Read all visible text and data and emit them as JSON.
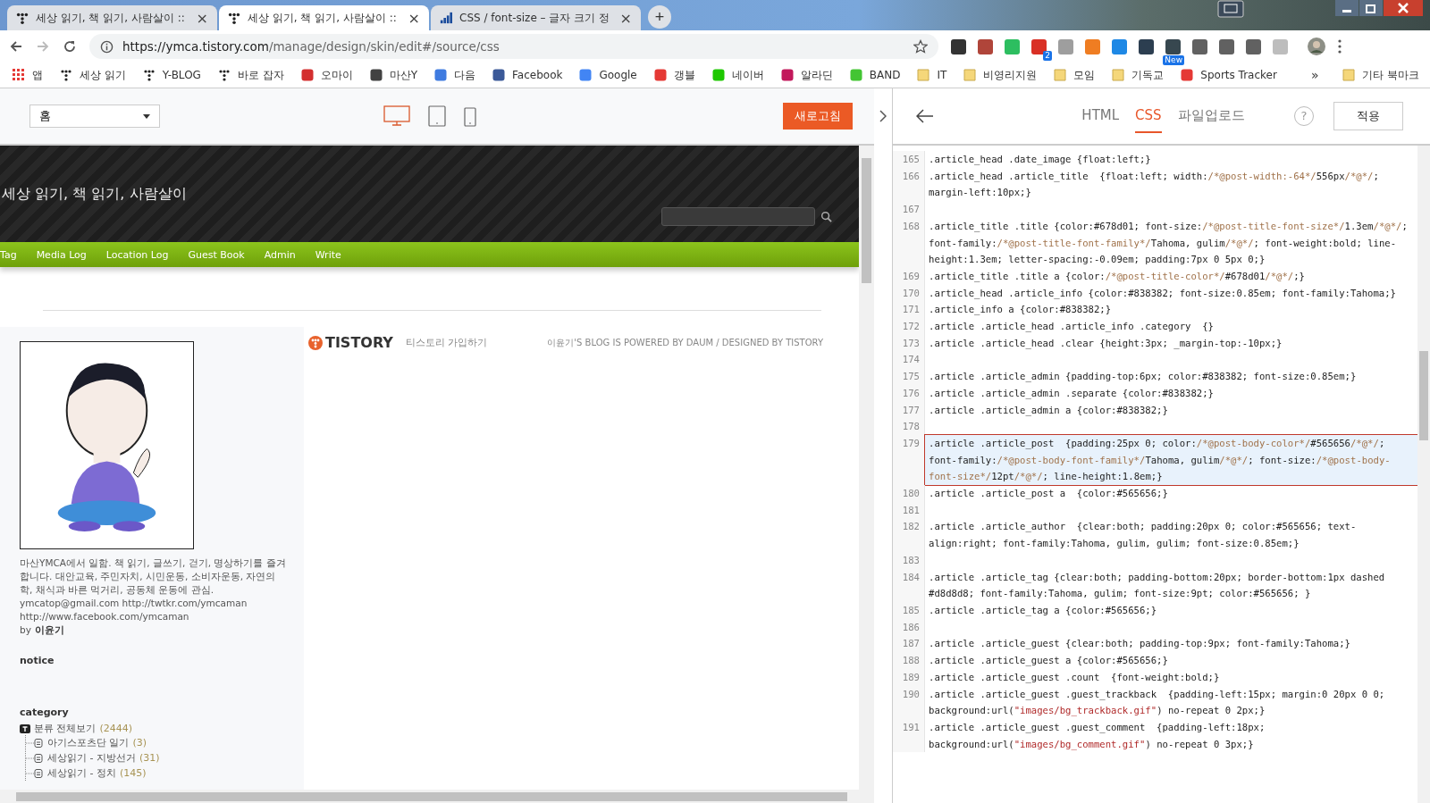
{
  "browser": {
    "tabs": [
      {
        "title": "세상 읽기, 책 읽기, 사람살이 ::",
        "kind": "dots",
        "selected": false,
        "close": "×"
      },
      {
        "title": "세상 읽기, 책 읽기, 사람살이 ::",
        "kind": "dots",
        "selected": true,
        "close": "×"
      },
      {
        "title": "CSS / font-size – 글자 크기 정",
        "kind": "bars",
        "selected": false,
        "close": "×"
      }
    ],
    "new_tab": "+",
    "url": {
      "host": "https://ymca.tistory.com",
      "path": "/manage/design/skin/edit#/source/css"
    },
    "extensions": [
      {
        "color": "#333333"
      },
      {
        "color": "#b0453a"
      },
      {
        "color": "#2dbe60"
      },
      {
        "color": "#d93025",
        "badge": "2"
      },
      {
        "color": "#9e9e9e"
      },
      {
        "color": "#ef7d22"
      },
      {
        "color": "#1e88e5"
      },
      {
        "color": "#2c3e50"
      },
      {
        "color": "#37474f",
        "badge": "New"
      },
      {
        "color": "#616161"
      },
      {
        "color": "#616161"
      },
      {
        "color": "#616161"
      },
      {
        "color": "#bdbdbd"
      }
    ],
    "bookmarks": [
      {
        "label": "앱",
        "kind": "apps",
        "color": "#e53935"
      },
      {
        "label": "세상 읽기",
        "kind": "dots",
        "color": "#222222"
      },
      {
        "label": "Y-BLOG",
        "kind": "dots",
        "color": "#222222"
      },
      {
        "label": "바로 잡자",
        "kind": "dots",
        "color": "#222222"
      },
      {
        "label": "오마이",
        "kind": "site",
        "color": "#d32f2f"
      },
      {
        "label": "마산Y",
        "kind": "site",
        "color": "#424242"
      },
      {
        "label": "다음",
        "kind": "site",
        "color": "#3f7be0"
      },
      {
        "label": "Facebook",
        "kind": "site",
        "color": "#3b5998"
      },
      {
        "label": "Google",
        "kind": "site",
        "color": "#4285f4"
      },
      {
        "label": "갱블",
        "kind": "site",
        "color": "#e53935"
      },
      {
        "label": "네이버",
        "kind": "site",
        "color": "#1ec800"
      },
      {
        "label": "알라딘",
        "kind": "site",
        "color": "#c2185b"
      },
      {
        "label": "BAND",
        "kind": "site",
        "color": "#43c533"
      },
      {
        "label": "IT",
        "kind": "folder",
        "color": "#f5d77a"
      },
      {
        "label": "비영리지원",
        "kind": "folder",
        "color": "#f5d77a"
      },
      {
        "label": "모임",
        "kind": "folder",
        "color": "#f5d77a"
      },
      {
        "label": "기독교",
        "kind": "folder",
        "color": "#f5d77a"
      },
      {
        "label": "Sports Tracker",
        "kind": "site",
        "color": "#e53935"
      }
    ],
    "bookmarks_more": "»",
    "other_bookmarks": "기타 북마크"
  },
  "preview_toolbar": {
    "page_select": "홈",
    "devices": [
      {
        "kind": "desktop",
        "selected": true
      },
      {
        "kind": "tablet",
        "selected": false
      },
      {
        "kind": "phone",
        "selected": false
      }
    ],
    "refresh_button": "새로고침"
  },
  "blog": {
    "title": "세상 읽기, 책 읽기, 사람살이",
    "nav": [
      "Tag",
      "Media Log",
      "Location Log",
      "Guest Book",
      "Admin",
      "Write"
    ],
    "profile": {
      "picture": {
        "kind": "picture"
      },
      "bio": "마산YMCA에서 일함. 책 읽기, 글쓰기, 걷기, 명상하기를 즐겨합니다. 대안교육, 주민자치, 시민운동, 소비자운동, 자연의학, 채식과 바른 먹거리, 공동체 운동에 관심.",
      "contact": [
        "ymcatop@gmail.com  http://twtkr.com/ymcaman",
        "http://www.facebook.com/ymcaman"
      ],
      "by": "by",
      "author": "이윤기"
    },
    "notice": "notice",
    "category": {
      "heading": "category",
      "root": {
        "label": "분류 전체보기",
        "count": "(2444)",
        "children": [
          {
            "label": "아기스포츠단 일기",
            "count": "(3)"
          },
          {
            "label": "세상읽기 - 지방선거",
            "count": "(31)"
          },
          {
            "label": "세상읽기 - 정치",
            "count": "(145)"
          }
        ]
      }
    },
    "footer": {
      "logo": "TISTORY",
      "join": "티스토리 가입하기",
      "credit": "이윤기'S BLOG IS POWERED BY DAUM / DESIGNED BY TISTORY"
    }
  },
  "editor": {
    "tabs": [
      {
        "label": "HTML",
        "selected": false
      },
      {
        "label": "CSS",
        "selected": true
      },
      {
        "label": "파일업로드",
        "selected": false
      }
    ],
    "help": "?",
    "apply_button": "적용",
    "lines": [
      {
        "num": "165",
        "text": ".article_head .date_image {float:left;}",
        "highlighted": false
      },
      {
        "num": "166",
        "text": ".article_head .article_title  {float:left; width:/*@post-width:-64*/556px/*@*/; margin-left:10px;}",
        "highlighted": false
      },
      {
        "num": "167",
        "highlighted": false
      },
      {
        "num": "168",
        "text": ".article_title .title {color:#678d01; font-size:/*@post-title-font-size*/1.3em/*@*/; font-family:/*@post-title-font-family*/Tahoma, gulim/*@*/; font-weight:bold; line-height:1.3em; letter-spacing:-0.09em; padding:7px 0 5px 0;}",
        "highlighted": false
      },
      {
        "num": "169",
        "text": ".article_title .title a {color:/*@post-title-color*/#678d01/*@*/;}",
        "highlighted": false
      },
      {
        "num": "170",
        "text": ".article_head .article_info {color:#838382; font-size:0.85em; font-family:Tahoma;}",
        "highlighted": false
      },
      {
        "num": "171",
        "text": ".article_info a {color:#838382;}",
        "highlighted": false
      },
      {
        "num": "172",
        "text": ".article .article_head .article_info .category  {}",
        "highlighted": false
      },
      {
        "num": "173",
        "text": ".article .article_head .clear {height:3px; _margin-top:-10px;}",
        "highlighted": false
      },
      {
        "num": "174",
        "highlighted": false
      },
      {
        "num": "175",
        "text": ".article .article_admin {padding-top:6px; color:#838382; font-size:0.85em;}",
        "highlighted": false
      },
      {
        "num": "176",
        "text": ".article .article_admin .separate {color:#838382;}",
        "highlighted": false
      },
      {
        "num": "177",
        "text": ".article .article_admin a {color:#838382;}",
        "highlighted": false
      },
      {
        "num": "178",
        "highlighted": false
      },
      {
        "num": "179",
        "text": ".article .article_post  {padding:25px 0; color:/*@post-body-color*/#565656/*@*/; font-family:/*@post-body-font-family*/Tahoma, gulim/*@*/; font-size:/*@post-body-font-size*/12pt/*@*/; line-height:1.8em;}",
        "highlighted": true
      },
      {
        "num": "180",
        "text": ".article .article_post a  {color:#565656;}",
        "highlighted": false
      },
      {
        "num": "181",
        "highlighted": false
      },
      {
        "num": "182",
        "text": ".article .article_author  {clear:both; padding:20px 0; color:#565656; text-align:right; font-family:Tahoma, gulim, gulim; font-size:0.85em;}",
        "highlighted": false
      },
      {
        "num": "183",
        "highlighted": false
      },
      {
        "num": "184",
        "text": ".article .article_tag {clear:both; padding-bottom:20px; border-bottom:1px dashed #d8d8d8; font-family:Tahoma, gulim; font-size:9pt; color:#565656; }",
        "highlighted": false
      },
      {
        "num": "185",
        "text": ".article .article_tag a {color:#565656;}",
        "highlighted": false
      },
      {
        "num": "186",
        "highlighted": false
      },
      {
        "num": "187",
        "text": ".article .article_guest {clear:both; padding-top:9px; font-family:Tahoma;}",
        "highlighted": false
      },
      {
        "num": "188",
        "text": ".article .article_guest a {color:#565656;}",
        "highlighted": false
      },
      {
        "num": "189",
        "text": ".article .article_guest .count  {font-weight:bold;}",
        "highlighted": false
      },
      {
        "num": "190",
        "text": ".article .article_guest .guest_trackback  {padding-left:15px; margin:0 20px 0 0; background:url(\"images/bg_trackback.gif\") no-repeat 0 2px;}",
        "highlighted": false
      },
      {
        "num": "191",
        "text": ".article .article_guest .guest_comment  {padding-left:18px; background:url(\"images/bg_comment.gif\") no-repeat 0 3px;}",
        "highlighted": false
      }
    ]
  }
}
